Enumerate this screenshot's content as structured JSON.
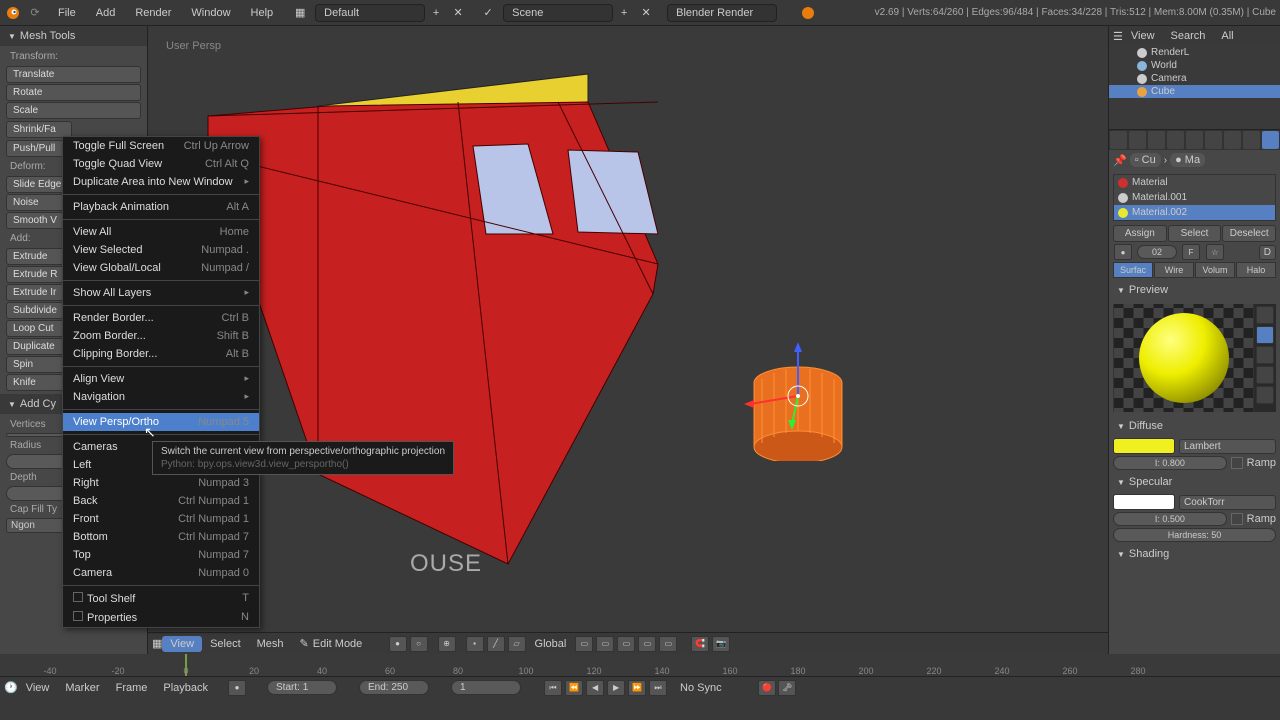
{
  "topbar": {
    "menus": [
      "File",
      "Add",
      "Render",
      "Window",
      "Help"
    ],
    "layout": "Default",
    "scene": "Scene",
    "engine": "Blender Render",
    "stats": "v2.69 | Verts:64/260 | Edges:96/484 | Faces:34/228 | Tris:512 | Mem:8.00M (0.35M) | Cube"
  },
  "left_panel": {
    "title": "Mesh Tools",
    "transform_label": "Transform:",
    "transform": [
      "Translate",
      "Rotate",
      "Scale"
    ],
    "shrink": "Shrink/Fa",
    "push": "Push/Pull",
    "deform_label": "Deform:",
    "deform": [
      "Slide Edge",
      "Noise",
      "Smooth V"
    ],
    "add_label": "Add:",
    "add": [
      "Extrude",
      "Extrude R",
      "Extrude Ir",
      "Subdivide",
      "Loop Cut",
      "Duplicate",
      "Spin",
      "Knife"
    ],
    "operator_title": "Add Cy",
    "vertices_label": "Vertices",
    "radius_label": "Radius",
    "depth_label": "Depth",
    "capfill_label": "Cap Fill Ty",
    "capfill": "Ngon"
  },
  "viewport": {
    "label": "User Persp",
    "scene_text": "OUSE"
  },
  "context_menu": {
    "items": [
      {
        "label": "Toggle Full Screen",
        "shortcut": "Ctrl Up Arrow"
      },
      {
        "label": "Toggle Quad View",
        "shortcut": "Ctrl Alt Q"
      },
      {
        "label": "Duplicate Area into New Window",
        "shortcut": "",
        "sub": true
      },
      {
        "sep": true
      },
      {
        "label": "Playback Animation",
        "shortcut": "Alt A"
      },
      {
        "sep": true
      },
      {
        "label": "View All",
        "shortcut": "Home"
      },
      {
        "label": "View Selected",
        "shortcut": "Numpad ."
      },
      {
        "label": "View Global/Local",
        "shortcut": "Numpad /"
      },
      {
        "sep": true
      },
      {
        "label": "Show All Layers",
        "shortcut": "",
        "sub": true
      },
      {
        "sep": true
      },
      {
        "label": "Render Border...",
        "shortcut": "Ctrl B"
      },
      {
        "label": "Zoom Border...",
        "shortcut": "Shift B"
      },
      {
        "label": "Clipping Border...",
        "shortcut": "Alt B"
      },
      {
        "sep": true
      },
      {
        "label": "Align View",
        "shortcut": "",
        "sub": true
      },
      {
        "label": "Navigation",
        "shortcut": "",
        "sub": true
      },
      {
        "sep": true
      },
      {
        "label": "View Persp/Ortho",
        "shortcut": "Numpad 5",
        "hl": true
      },
      {
        "sep": true
      },
      {
        "label": "Cameras",
        "shortcut": "",
        "sub": true
      },
      {
        "label": "Left",
        "shortcut": ""
      },
      {
        "label": "Right",
        "shortcut": "Numpad 3"
      },
      {
        "label": "Back",
        "shortcut": "Ctrl Numpad 1"
      },
      {
        "label": "Front",
        "shortcut": "Ctrl Numpad 1"
      },
      {
        "label": "Bottom",
        "shortcut": "Ctrl Numpad 7"
      },
      {
        "label": "Top",
        "shortcut": "Numpad 7"
      },
      {
        "label": "Camera",
        "shortcut": "Numpad 0"
      },
      {
        "sep": true
      },
      {
        "label": "Tool Shelf",
        "shortcut": "T",
        "check": true
      },
      {
        "label": "Properties",
        "shortcut": "N",
        "check": true
      }
    ]
  },
  "tooltip": {
    "line1": "Switch the current view from perspective/orthographic projection",
    "line2": "Python: bpy.ops.view3d.view_persportho()"
  },
  "vp_header": {
    "items": [
      "View",
      "Select",
      "Mesh"
    ],
    "mode": "Edit Mode",
    "orientation": "Global"
  },
  "outliner": {
    "header": [
      "View",
      "Search",
      "All"
    ],
    "items": [
      {
        "label": "RenderL",
        "icon": "#ccc"
      },
      {
        "label": "World",
        "icon": "#8ab4d8"
      },
      {
        "label": "Camera",
        "icon": "#ccc"
      },
      {
        "label": "Cube",
        "icon": "#e8a23f",
        "selected": true
      }
    ]
  },
  "properties": {
    "breadcrumb": [
      "",
      "Cu",
      "Ma"
    ],
    "materials": [
      {
        "name": "Material",
        "color": "#cc3030"
      },
      {
        "name": "Material.001",
        "color": "#cccccc"
      },
      {
        "name": "Material.002",
        "color": "#e8e830",
        "selected": true
      }
    ],
    "assign": "Assign",
    "select": "Select",
    "deselect": "Deselect",
    "id": "02",
    "data": "D",
    "shading": [
      "Surfac",
      "Wire",
      "Volum",
      "Halo"
    ],
    "preview_label": "Preview",
    "diffuse_label": "Diffuse",
    "diffuse_color": "#f0f020",
    "diffuse_model": "Lambert",
    "diffuse_intensity": "I: 0.800",
    "ramp_label": "Ramp",
    "specular_label": "Specular",
    "specular_color": "#ffffff",
    "specular_model": "CookTorr",
    "specular_intensity": "I: 0.500",
    "hardness": "Hardness: 50",
    "shading_label": "Shading"
  },
  "timeline": {
    "ticks": [
      "-40",
      "-20",
      "0",
      "20",
      "40",
      "60",
      "80",
      "100",
      "120",
      "140",
      "160",
      "180",
      "200",
      "220",
      "240",
      "260",
      "280"
    ],
    "menus": [
      "View",
      "Marker",
      "Frame",
      "Playback"
    ],
    "start": "Start: 1",
    "end": "End: 250",
    "current": "1",
    "sync": "No Sync"
  }
}
